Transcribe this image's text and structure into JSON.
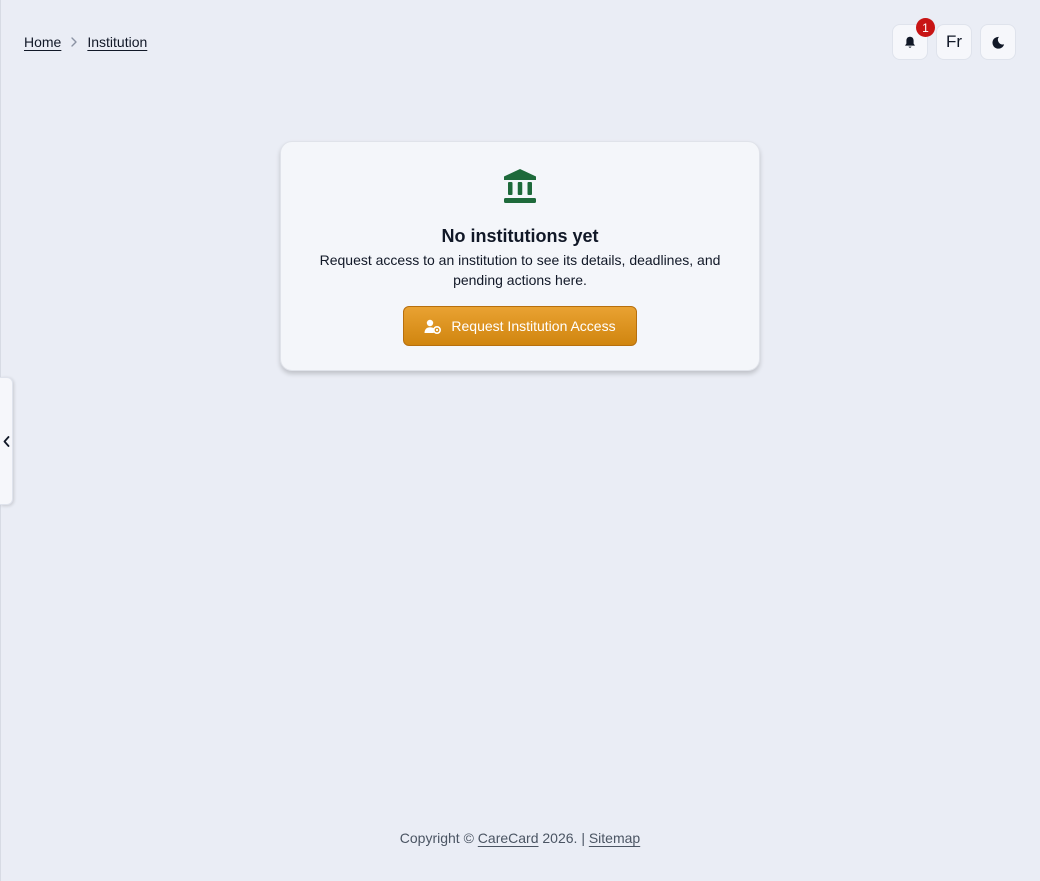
{
  "breadcrumb": {
    "home": "Home",
    "current": "Institution"
  },
  "header": {
    "notifications_count": "1",
    "language_label": "Fr",
    "notification_icon": "bell-icon",
    "theme_icon": "moon-icon"
  },
  "empty_state": {
    "icon": "institution-icon",
    "title": "No institutions yet",
    "description": "Request access to an institution to see its details, deadlines, and pending actions here.",
    "button_label": "Request Institution Access",
    "button_icon": "user-gear-icon"
  },
  "sidebar_toggle_icon": "chevron-left-icon",
  "footer": {
    "copyright_prefix": "Copyright ©",
    "brand": "CareCard",
    "year_suffix": "2026. |",
    "sitemap": "Sitemap"
  },
  "colors": {
    "background": "#eaedf5",
    "accent_green": "#1e6a3b",
    "button_orange": "#dc9120",
    "badge_red": "#c81414"
  }
}
